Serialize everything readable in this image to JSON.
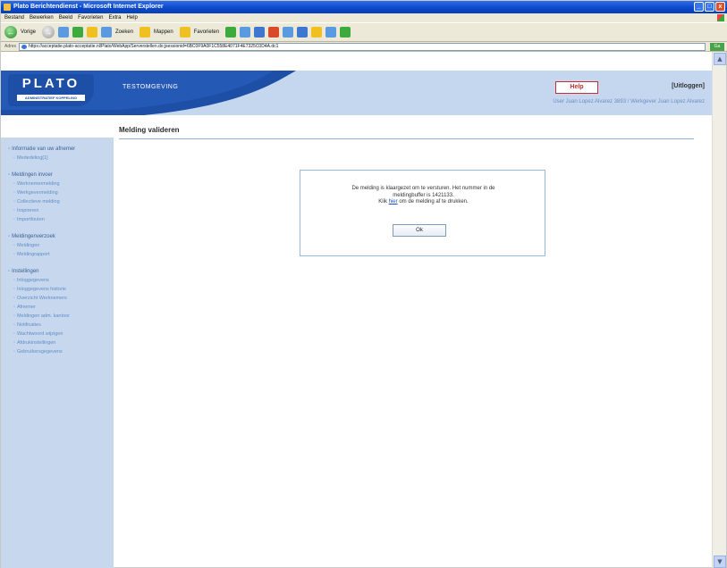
{
  "window": {
    "title": "Plato Berichtendienst - Microsoft Internet Explorer",
    "buttons": [
      "_",
      "□",
      "x"
    ]
  },
  "menubar": [
    "Bestand",
    "Bewerken",
    "Beeld",
    "Favorieten",
    "Extra",
    "Help"
  ],
  "toolbar": {
    "back_label": "Vorige",
    "search_label": "Zoeken",
    "folders_label": "Mappen",
    "favorites_label": "Favorieten"
  },
  "address": {
    "label": "Adres",
    "url": "https://acceptatie.plato-acceptatie.nl/Plato/WebApp/Serverstellen.do;jsessionid=6BC0F9A0F1C558E4071F4E7325C0D4A.dc1",
    "go": "Ga naar"
  },
  "header": {
    "logo_text": "PLATO",
    "logo_subtitle": "ADMINISTRATIEF KOPPELING",
    "environment": "TESTOMGEVING",
    "help_label": "Help",
    "logout_label": "[Uitloggen]",
    "user_line": "User Juan Lopez Alvarez 3893 / Werkgever Juan Lopez Alvarez"
  },
  "sidebar": {
    "sections": [
      {
        "title": "Informatie van uw afnemer",
        "items": [
          "Mededeling[1]"
        ]
      },
      {
        "title": "Meldingen invoer",
        "items": [
          "Werknemermelding",
          "Werkgevermelding",
          "Collectieve melding",
          "Inspireren",
          "Importfouten"
        ]
      },
      {
        "title": "Meldingenverzoek",
        "items": [
          "Meldingen",
          "Meldingrapport"
        ]
      },
      {
        "title": "Instellingen",
        "items": [
          "Inloggegevens",
          "Inloggegevens historie",
          "Overzicht Werknemers",
          "Afnemer",
          "Meldingen adm. kantoor",
          "Notificaties",
          "Wachtwoord wijzigen",
          "Afdrukinstellingen",
          "Gebruikersgegevens"
        ]
      }
    ]
  },
  "main": {
    "page_title": "Melding valideren",
    "dialog": {
      "line1": "De melding is klaargezet om te versturen. Het nummer in de",
      "line2": "meldingbuffer is 1421133.",
      "line3_pre": "Klik",
      "link": "hier",
      "line3_post": "om de melding af te drukken.",
      "ok_label": "Ok"
    }
  },
  "colors": {
    "title_bar": "#0a46c8",
    "header_bg": "#c5d7ee",
    "logo_blue": "#1d4fa6",
    "sidebar_bg": "#c7d8ee",
    "help_red": "#c03030"
  }
}
